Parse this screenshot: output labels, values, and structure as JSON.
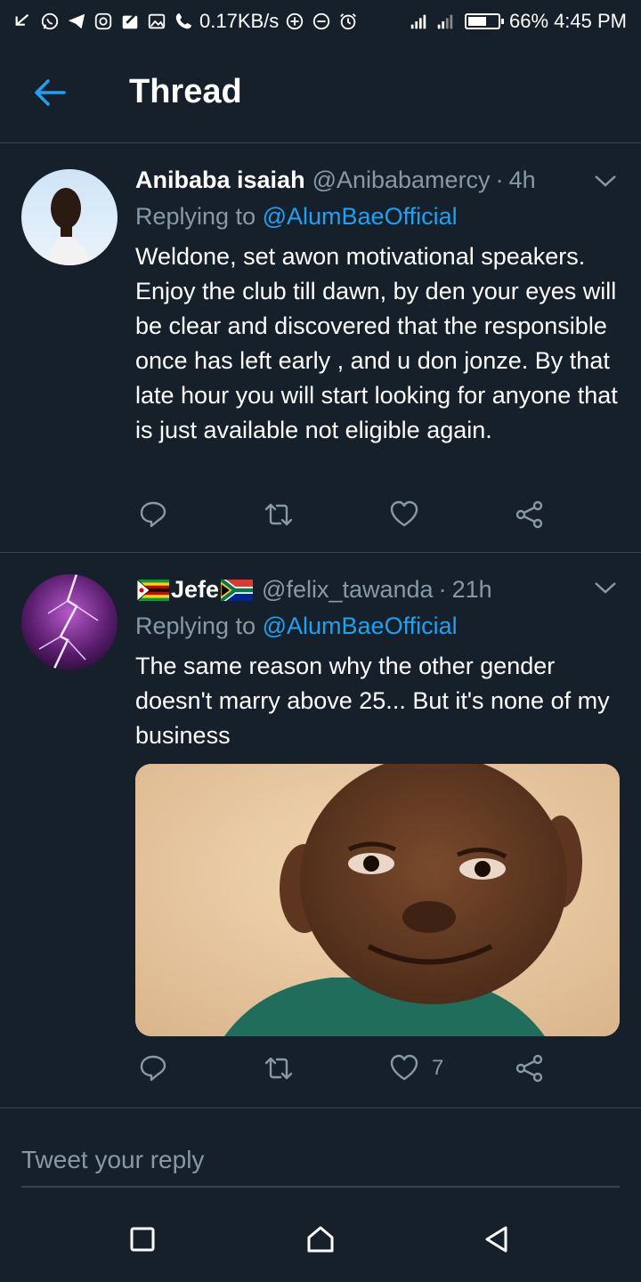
{
  "status_bar": {
    "network_speed": "0.17KB/s",
    "battery": "66%",
    "battery_level": 0.66,
    "time": "4:45 PM"
  },
  "header": {
    "title": "Thread"
  },
  "tweets": [
    {
      "name": "Anibaba isaiah",
      "handle": "@Anibabamercy",
      "dot": "·",
      "time": "4h",
      "replying_prefix": "Replying to",
      "replying_to": "@AlumBaeOfficial",
      "text": "Weldone, set awon motivational speakers. Enjoy the club till dawn, by den your eyes will be clear and discovered that the responsible once has left early , and u don jonze. By that late hour you will start looking for anyone that is just available not eligible again.",
      "like_count": ""
    },
    {
      "name": "Jefe",
      "handle": "@felix_tawanda",
      "dot": "·",
      "time": "21h",
      "replying_prefix": "Replying to",
      "replying_to": "@AlumBaeOfficial",
      "text": "The same reason why the other gender doesn't marry above 25... But it's none of my business",
      "like_count": "7"
    }
  ],
  "reply": {
    "placeholder": "Tweet your reply"
  },
  "colors": {
    "background": "#15202b",
    "accent": "#1da1f2",
    "secondary_text": "#8899a6",
    "divider": "#38444d"
  }
}
